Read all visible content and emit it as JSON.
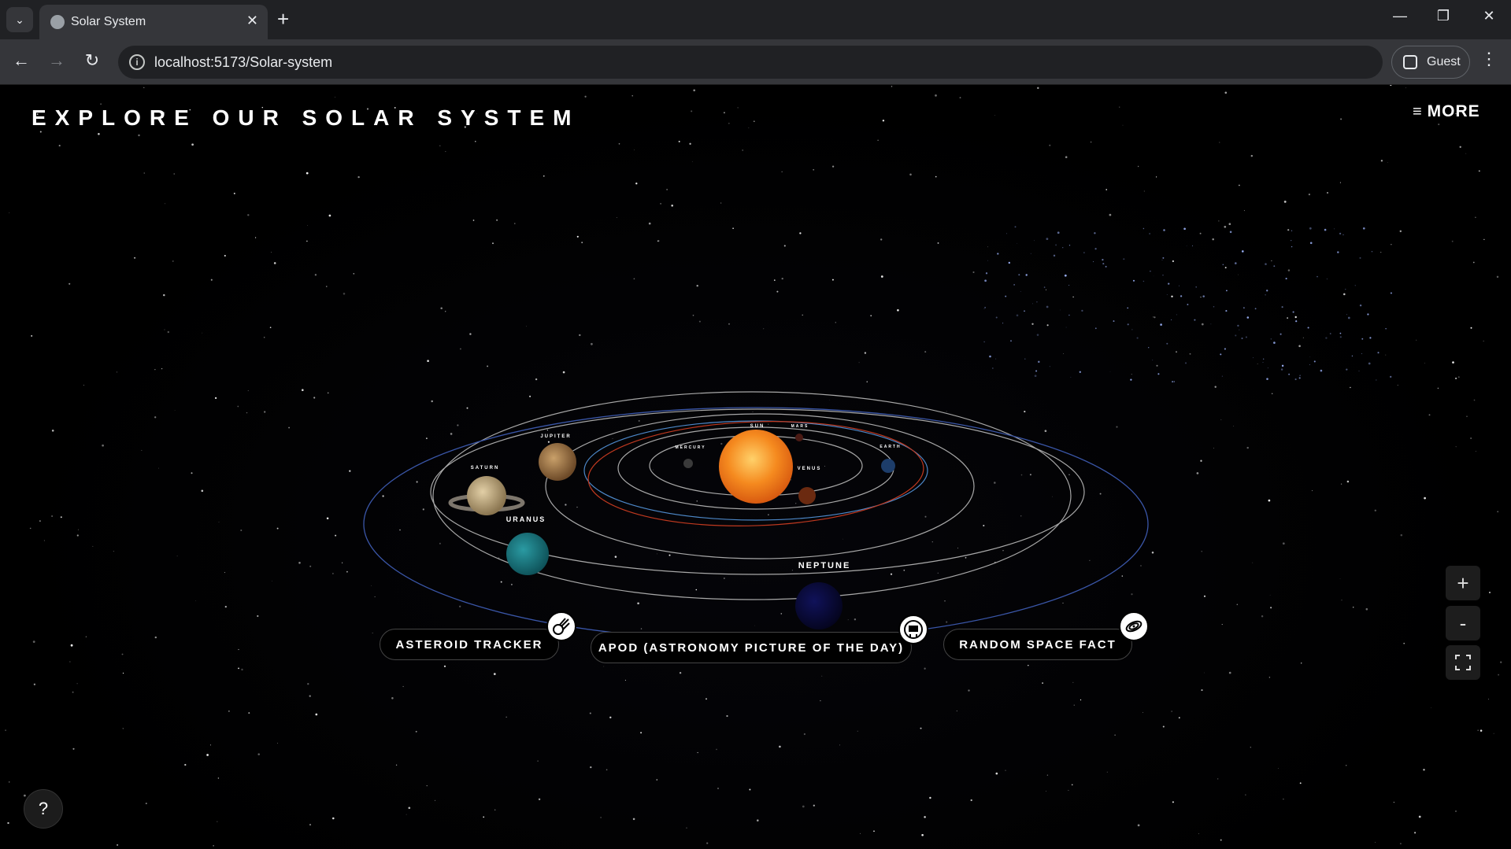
{
  "browser": {
    "tab_title": "Solar System",
    "url": "localhost:5173/Solar-system",
    "profile_label": "Guest"
  },
  "page": {
    "title": "EXPLORE OUR SOLAR SYSTEM",
    "more_label": "MORE",
    "planets": {
      "sun": "SUN",
      "mercury": "MERCURY",
      "venus": "VENUS",
      "earth": "EARTH",
      "mars": "MARS",
      "jupiter": "JUPITER",
      "saturn": "SATURN",
      "uranus": "URANUS",
      "neptune": "NEPTUNE"
    },
    "buttons": {
      "asteroid": "ASTEROID TRACKER",
      "apod": "APOD (ASTRONOMY PICTURE OF THE DAY)",
      "fact": "RANDOM SPACE FACT"
    },
    "help_label": "?",
    "zoom_in_label": "+",
    "zoom_out_label": "-"
  },
  "colors": {
    "orbit_inner": "#a8a8a8",
    "orbit_mars": "#c0391f",
    "orbit_earth": "#4d88c8",
    "orbit_outer": "#3a56a8",
    "sun": "#f58a1f",
    "uranus": "#1a7d84",
    "neptune": "#0a0a44"
  }
}
